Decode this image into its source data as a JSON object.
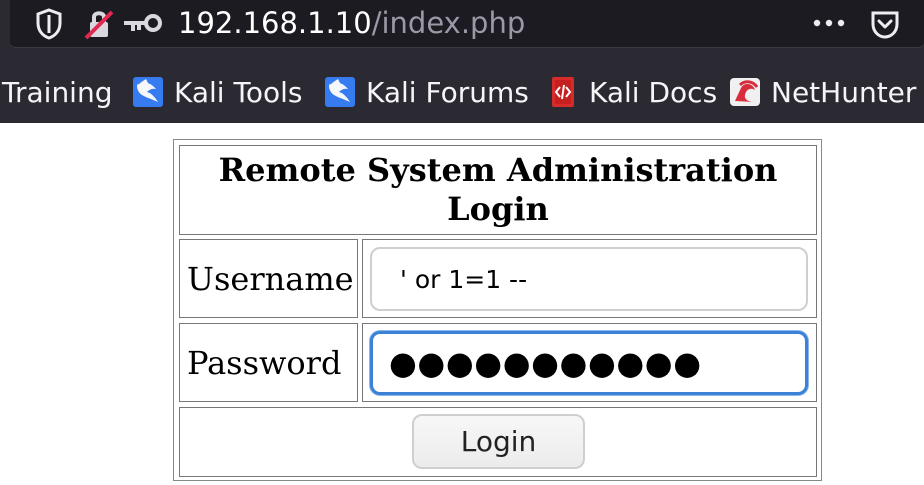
{
  "browser": {
    "address": {
      "host": "192.168.1.10",
      "path": "/index.php"
    },
    "toolbar": {
      "shield_icon": "shield-icon",
      "insecure_lock_icon": "insecure-lock-icon",
      "key_icon": "key-icon",
      "more_icon": "more-icon",
      "pocket_icon": "pocket-icon"
    },
    "bookmarks": [
      {
        "label": "Training",
        "icon": ""
      },
      {
        "label": "Kali Tools",
        "icon": "kali-dragon-icon"
      },
      {
        "label": "Kali Forums",
        "icon": "kali-dragon-icon"
      },
      {
        "label": "Kali Docs",
        "icon": "kali-docs-icon"
      },
      {
        "label": "NetHunter",
        "icon": "nethunter-icon"
      }
    ]
  },
  "login_form": {
    "title": "Remote System Administration Login",
    "username": {
      "label": "Username",
      "value": "' or 1=1 --"
    },
    "password": {
      "label": "Password",
      "value": "●●●●●●●●●●●"
    },
    "button_label": "Login"
  },
  "colors": {
    "browser_bg": "#2b2a33",
    "url_bg": "#1c1b22",
    "focus_blue": "#3b82d6",
    "kali_blue": "#367bf0",
    "kali_docs_red": "#d72b2b"
  }
}
